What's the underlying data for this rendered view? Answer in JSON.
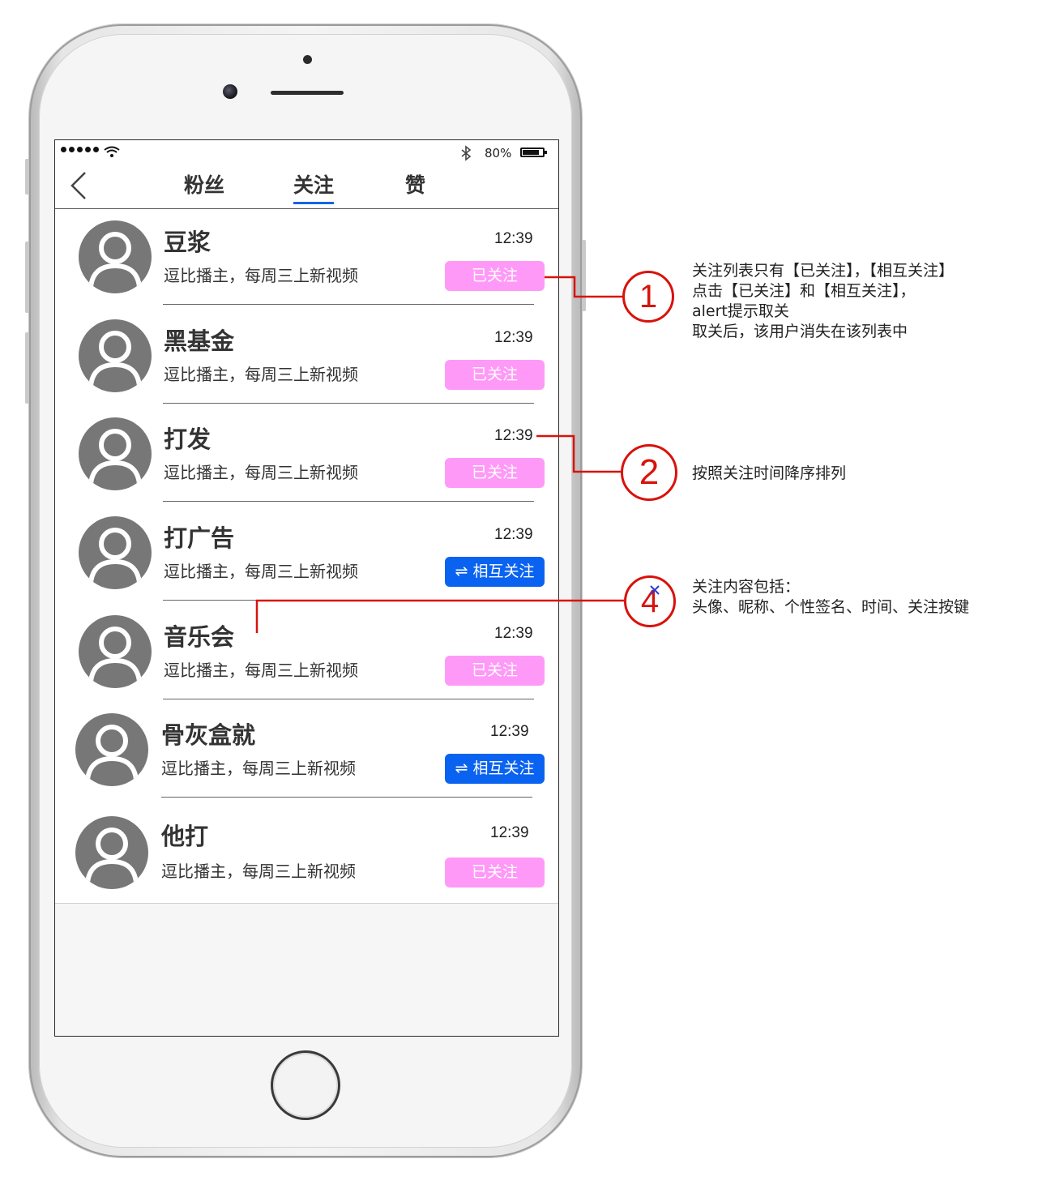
{
  "status_bar": {
    "battery": "80%",
    "signal_icon": "signal-dots-icon",
    "wifi_icon": "wifi-icon",
    "bluetooth_icon": "bluetooth-icon",
    "battery_icon": "battery-icon"
  },
  "nav": {
    "back_icon": "back-chevron-icon",
    "tabs": [
      {
        "label": "粉丝",
        "active": false
      },
      {
        "label": "关注",
        "active": true
      },
      {
        "label": "赞",
        "active": false
      }
    ]
  },
  "colors": {
    "followed_button": "#ff99f7",
    "mutual_button": "#0a63f0",
    "tab_underline": "#1565e8",
    "annotation": "#d9120b"
  },
  "list": [
    {
      "name": "豆浆",
      "signature": "逗比播主，每周三上新视频",
      "time": "12:39",
      "button": "已关注",
      "type": "followed"
    },
    {
      "name": "黑基金",
      "signature": "逗比播主，每周三上新视频",
      "time": "12:39",
      "button": "已关注",
      "type": "followed"
    },
    {
      "name": "打发",
      "signature": "逗比播主，每周三上新视频",
      "time": "12:39",
      "button": "已关注",
      "type": "followed"
    },
    {
      "name": "打广告",
      "signature": "逗比播主，每周三上新视频",
      "time": "12:39",
      "button": "⇌ 相互关注",
      "type": "mutual"
    },
    {
      "name": "音乐会",
      "signature": "逗比播主，每周三上新视频",
      "time": "12:39",
      "button": "已关注",
      "type": "followed"
    },
    {
      "name": "骨灰盒就",
      "signature": "逗比播主，每周三上新视频",
      "time": "12:39",
      "button": "⇌ 相互关注",
      "type": "mutual"
    },
    {
      "name": "他打",
      "signature": "逗比播主，每周三上新视频",
      "time": "12:39",
      "button": "已关注",
      "type": "followed"
    }
  ],
  "annotations": [
    {
      "number": "1",
      "lines": [
        "关注列表只有【已关注】，【相互关注】",
        "点击【已关注】和【相互关注】，",
        "alert提示取关",
        "取关后，该用户消失在该列表中"
      ]
    },
    {
      "number": "2",
      "lines": [
        "按照关注时间降序排列"
      ]
    },
    {
      "number": "4",
      "lines": [
        "关注内容包括：",
        "头像、昵称、个性签名、时间、关注按键"
      ]
    }
  ]
}
